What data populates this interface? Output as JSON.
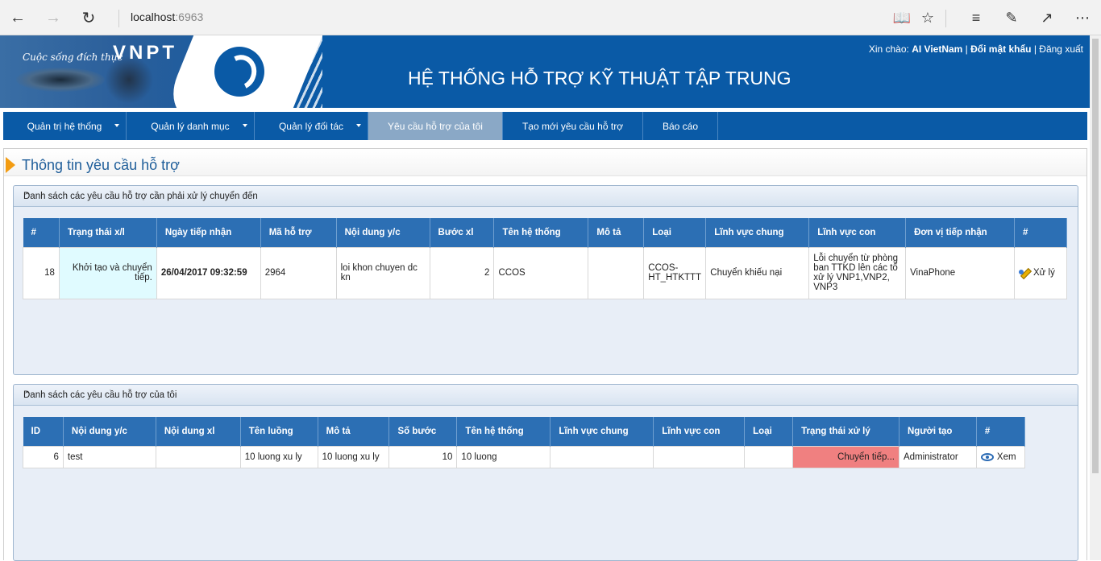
{
  "browser": {
    "url_host": "localhost",
    "url_port": ":6963",
    "back_icon": "back-arrow-icon",
    "forward_icon": "forward-arrow-icon",
    "refresh_icon": "refresh-icon",
    "reader_icon": "reading-view-icon",
    "favorite_icon": "star-icon",
    "hub_icon": "hub-icon",
    "notes_icon": "pen-icon",
    "share_icon": "share-icon",
    "more_icon": "more-icon"
  },
  "header": {
    "slogan": "Cuộc sống đích thực",
    "brand": "VNPT",
    "system_title": "HỆ THỐNG HỖ TRỢ KỸ THUẬT TẬP TRUNG",
    "greeting": "Xin chào:",
    "user_name": "AI VietNam",
    "change_password": "Đổi mật khẩu",
    "logout": "Đăng xuất"
  },
  "menu": [
    {
      "label": "Quản trị hệ thống",
      "caret": true,
      "active": false
    },
    {
      "label": "Quản lý danh mục",
      "caret": true,
      "active": false
    },
    {
      "label": "Quản lý đối tác",
      "caret": true,
      "active": false
    },
    {
      "label": "Yêu cầu hỗ trợ của tôi",
      "caret": false,
      "active": true
    },
    {
      "label": "Tạo mới yêu cầu hỗ trợ",
      "caret": false,
      "active": false
    },
    {
      "label": "Báo cáo",
      "caret": false,
      "active": false
    }
  ],
  "page_title": "Thông tin yêu cầu hỗ trợ",
  "panel1": {
    "title": "Danh sách các yêu cầu hỗ trợ cần phải xử lý chuyển đến",
    "columns": [
      "#",
      "Trạng thái x/l",
      "Ngày tiếp nhận",
      "Mã hỗ trợ",
      "Nội dung y/c",
      "Bước xl",
      "Tên hệ thống",
      "Mô tả",
      "Loại",
      "Lĩnh vực chung",
      "Lĩnh vực con",
      "Đơn vị tiếp nhận",
      "#"
    ],
    "row": {
      "no": "18",
      "status": "Khởi tạo và chuyển tiếp.",
      "date": "26/04/2017 09:32:59",
      "code": "2964",
      "content": "loi khon chuyen dc kn",
      "step": "2",
      "system": "CCOS",
      "desc": "",
      "type": "CCOS-HT_HTKTTT",
      "field": "Chuyển khiếu nại",
      "subfield": "Lỗi chuyển từ phòng ban TTKD lên các tổ xử lý VNP1,VNP2, VNP3",
      "unit": "VinaPhone",
      "action": "Xử lý"
    }
  },
  "panel2": {
    "title": "Danh sách các yêu cầu hỗ trợ của tôi",
    "columns": [
      "ID",
      "Nội dung y/c",
      "Nội dung xl",
      "Tên luồng",
      "Mô tả",
      "Số bước",
      "Tên hệ thống",
      "Lĩnh vực chung",
      "Lĩnh vực con",
      "Loại",
      "Trạng thái xử lý",
      "Người tạo",
      "#"
    ],
    "row": {
      "id": "6",
      "content": "test",
      "process": "",
      "flow": "10 luong xu ly",
      "desc": "10 luong xu ly",
      "steps": "10",
      "system": "10 luong",
      "field": "",
      "subfield": "",
      "type": "",
      "status": "Chuyển tiếp...",
      "creator": "Administrator",
      "action": "Xem"
    }
  },
  "colors": {
    "primary": "#0a5aa6",
    "table_header": "#2c6fb4",
    "status_red": "#f08080",
    "status_light": "#e0fbff"
  }
}
